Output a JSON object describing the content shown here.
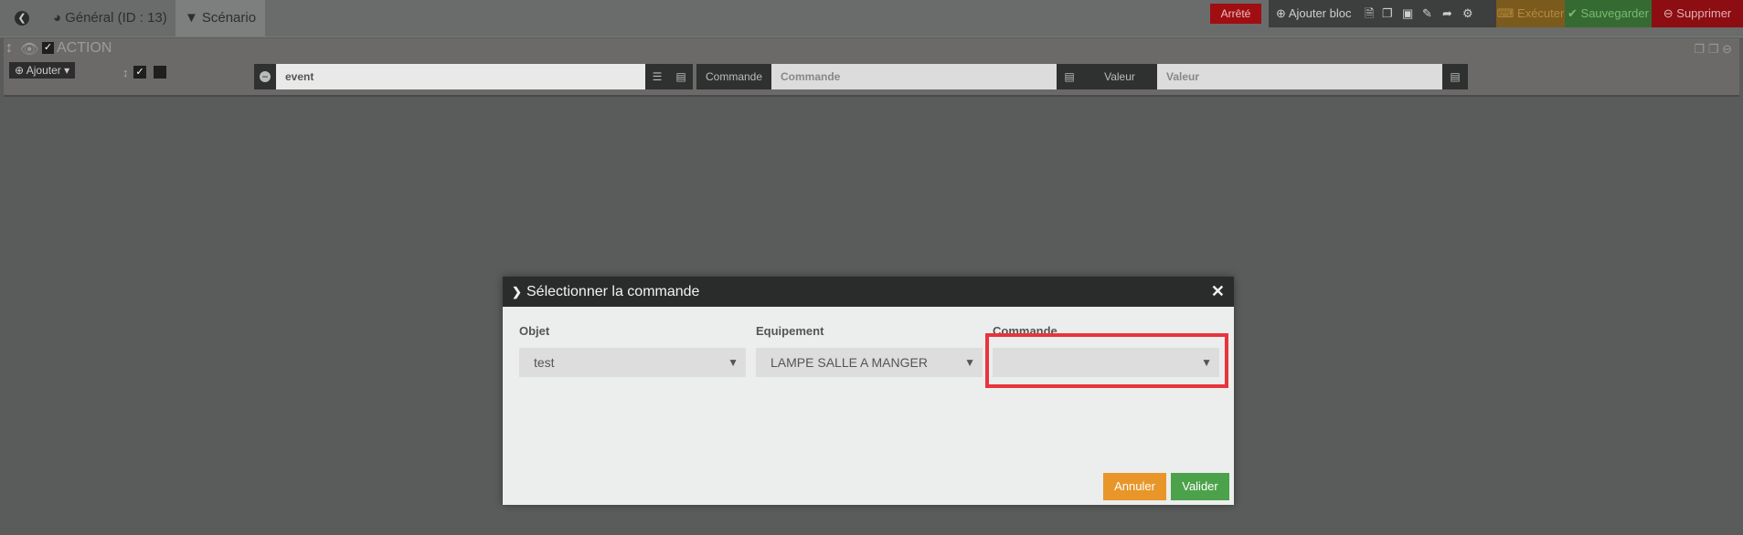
{
  "topbar": {
    "back_icon": "arrow-circle-left-icon",
    "tabs": [
      {
        "label": "Général (ID : 13)",
        "icon": "dashboard-icon"
      },
      {
        "label": "Scénario",
        "icon": "filter-icon"
      }
    ],
    "status_label": "Arrêté",
    "add_block_label": "Ajouter bloc",
    "execute_label": "Exécuter",
    "save_label": "Sauvegarder",
    "delete_label": "Supprimer"
  },
  "action_block": {
    "title": "ACTION",
    "add_label": "Ajouter",
    "command_value": "event",
    "commande_label": "Commande",
    "commande_placeholder": "Commande",
    "valeur_label": "Valeur",
    "valeur_placeholder": "Valeur"
  },
  "modal": {
    "title": "Sélectionner la commande",
    "fields": [
      {
        "label": "Objet",
        "value": "test"
      },
      {
        "label": "Equipement",
        "value": "LAMPE SALLE A MANGER"
      },
      {
        "label": "Commande",
        "value": ""
      }
    ],
    "cancel_label": "Annuler",
    "ok_label": "Valider"
  },
  "colors": {
    "stopped": "#a00e12",
    "execute": "#7b5a1e",
    "save": "#356b32",
    "delete": "#8c0d12",
    "cancel": "#e8962a",
    "ok": "#4ca24a",
    "highlight": "#e8343d"
  }
}
